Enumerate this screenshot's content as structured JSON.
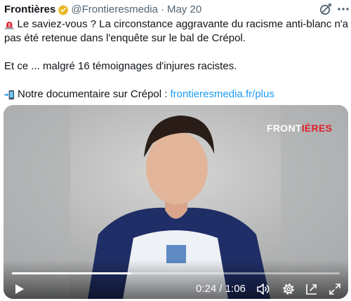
{
  "header": {
    "author_name": "Frontières",
    "handle": "@Frontieresmedia",
    "separator": "·",
    "date": "May 20"
  },
  "tweet": {
    "line1": "Le saviez-vous ? La circonstance aggravante du racisme anti-blanc n'a",
    "line2": "pas été retenue dans l'enquête sur le bal de Crépol.",
    "line3": "Et ce ... malgré 16 témoignages d'injures racistes.",
    "line4_text": "Notre documentaire sur Crépol :",
    "line4_link": "frontieresmedia.fr/plus"
  },
  "icons": {
    "alert": "rotating-light-icon",
    "phone": "mobile-phone-arrow-icon",
    "verified": "verified-badge-icon",
    "grok": "grok-icon",
    "more": "more-options-icon"
  },
  "video": {
    "watermark_main": "FRONT",
    "watermark_accent": "IÈRES",
    "time": "0:24 / 1:06",
    "progress": 0.364
  },
  "colors": {
    "link": "#1d9bf0",
    "verified": "#e8b829",
    "secondary_text": "#536471",
    "watermark_accent": "#e0202a"
  }
}
